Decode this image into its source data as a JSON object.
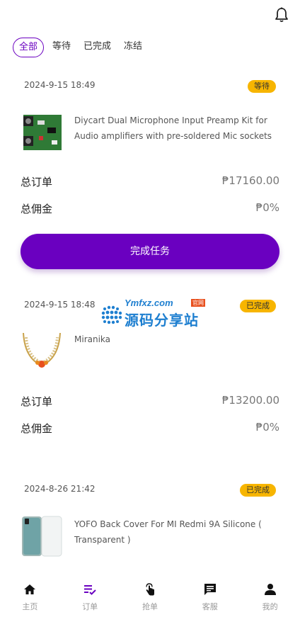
{
  "tabs": [
    "全部",
    "等待",
    "已完成",
    "冻结"
  ],
  "orders": [
    {
      "date": "2024-9-15 18:49",
      "status": "等待",
      "product": "Diycart Dual Microphone Input Preamp Kit for Audio amplifiers with pre-soldered Mic sockets",
      "total_order_label": "总订单",
      "total_order_value": "₱17160.00",
      "commission_label": "总佣金",
      "commission_value": "₱0%",
      "button": "完成任务"
    },
    {
      "date": "2024-9-15 18:48",
      "status": "已完成",
      "product": "Miranika",
      "total_order_label": "总订单",
      "total_order_value": "₱13200.00",
      "commission_label": "总佣金",
      "commission_value": "₱0%"
    },
    {
      "date": "2024-8-26 21:42",
      "status": "已完成",
      "product": "YOFO Back Cover For MI Redmi 9A Silicone ( Transparent )"
    }
  ],
  "watermark": {
    "top": "Ymfxz.com",
    "tag": "官网",
    "main": "源码分享站"
  },
  "nav": [
    {
      "label": "主页",
      "icon": "home-icon"
    },
    {
      "label": "订单",
      "icon": "orders-icon"
    },
    {
      "label": "抢单",
      "icon": "grab-order-icon"
    },
    {
      "label": "客服",
      "icon": "customer-service-icon"
    },
    {
      "label": "我的",
      "icon": "profile-icon"
    }
  ],
  "colors": {
    "accent": "#6a00c0",
    "badge": "#f7b500"
  }
}
